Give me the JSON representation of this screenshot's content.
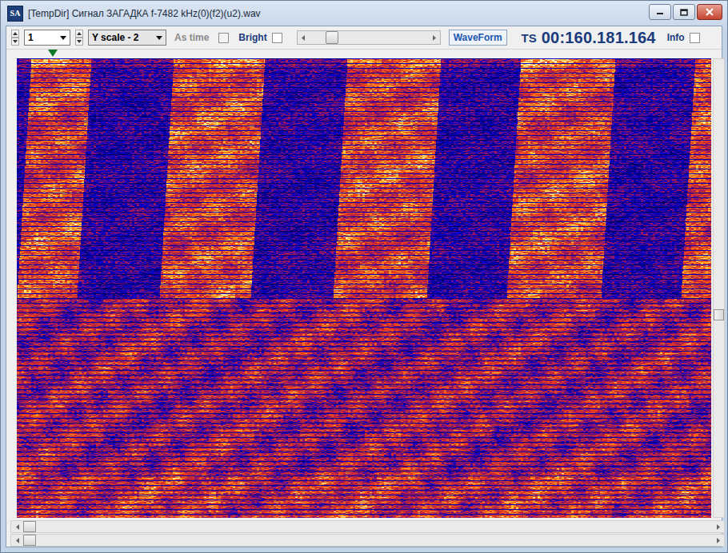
{
  "window": {
    "title": "[TempDir] Сигнал ЗАГАДКА f-7482 kHz(0)(f2)(u2).wav",
    "icon": "SA"
  },
  "toolbar": {
    "channel": {
      "value": "1"
    },
    "scale": {
      "value": "Y scale - 2"
    },
    "as_time": {
      "label": "As time",
      "checked": false,
      "disabled": true
    },
    "bright": {
      "label": "Bright",
      "checked": false
    },
    "slider": {
      "level": 0.16
    },
    "waveform": {
      "label": "WaveForm"
    },
    "ts": {
      "label": "TS",
      "value": "00:160.181.164"
    },
    "info": {
      "label": "Info",
      "checked": false
    }
  },
  "marker": {
    "level": 0.052
  },
  "v_scroll": {
    "level": 0.56
  },
  "h_scrolls": [
    {
      "level": 0.0
    },
    {
      "level": 0.0
    }
  ]
}
